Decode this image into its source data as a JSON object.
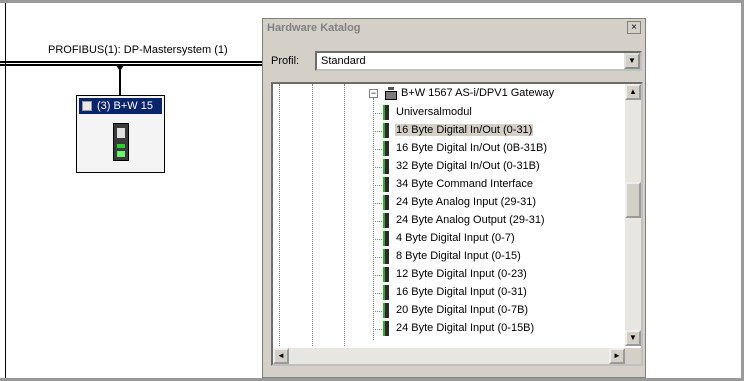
{
  "network": {
    "bus_label": "PROFIBUS(1): DP-Mastersystem (1)",
    "slave": {
      "title": "(3) B+W 15"
    }
  },
  "catalog": {
    "title": "Hardware Katalog",
    "close_glyph": "×",
    "profile_label": "Profil:",
    "profile_value": "Standard",
    "tree": {
      "expand_glyph": "−",
      "gateway_label": "B+W 1567 AS-i/DPV1 Gateway",
      "items": [
        "Universalmodul",
        "16 Byte Digital In/Out (0-31)",
        "16 Byte Digital In/Out (0B-31B)",
        "32 Byte Digital In/Out (0-31B)",
        "34 Byte Command Interface",
        "24 Byte Analog Input (29-31)",
        "24 Byte Analog Output (29-31)",
        "4 Byte Digital Input (0-7)",
        "8 Byte Digital Input (0-15)",
        "12 Byte Digital Input (0-23)",
        "16 Byte Digital Input (0-31)",
        "20 Byte Digital Input (0-7B)",
        "24 Byte Digital Input (0-15B)"
      ],
      "selected_index": 1
    }
  },
  "colors": {
    "selection": "#d4d0c8",
    "titlebar_active": "#0a246a",
    "titlebar_inactive_text": "#808080"
  }
}
